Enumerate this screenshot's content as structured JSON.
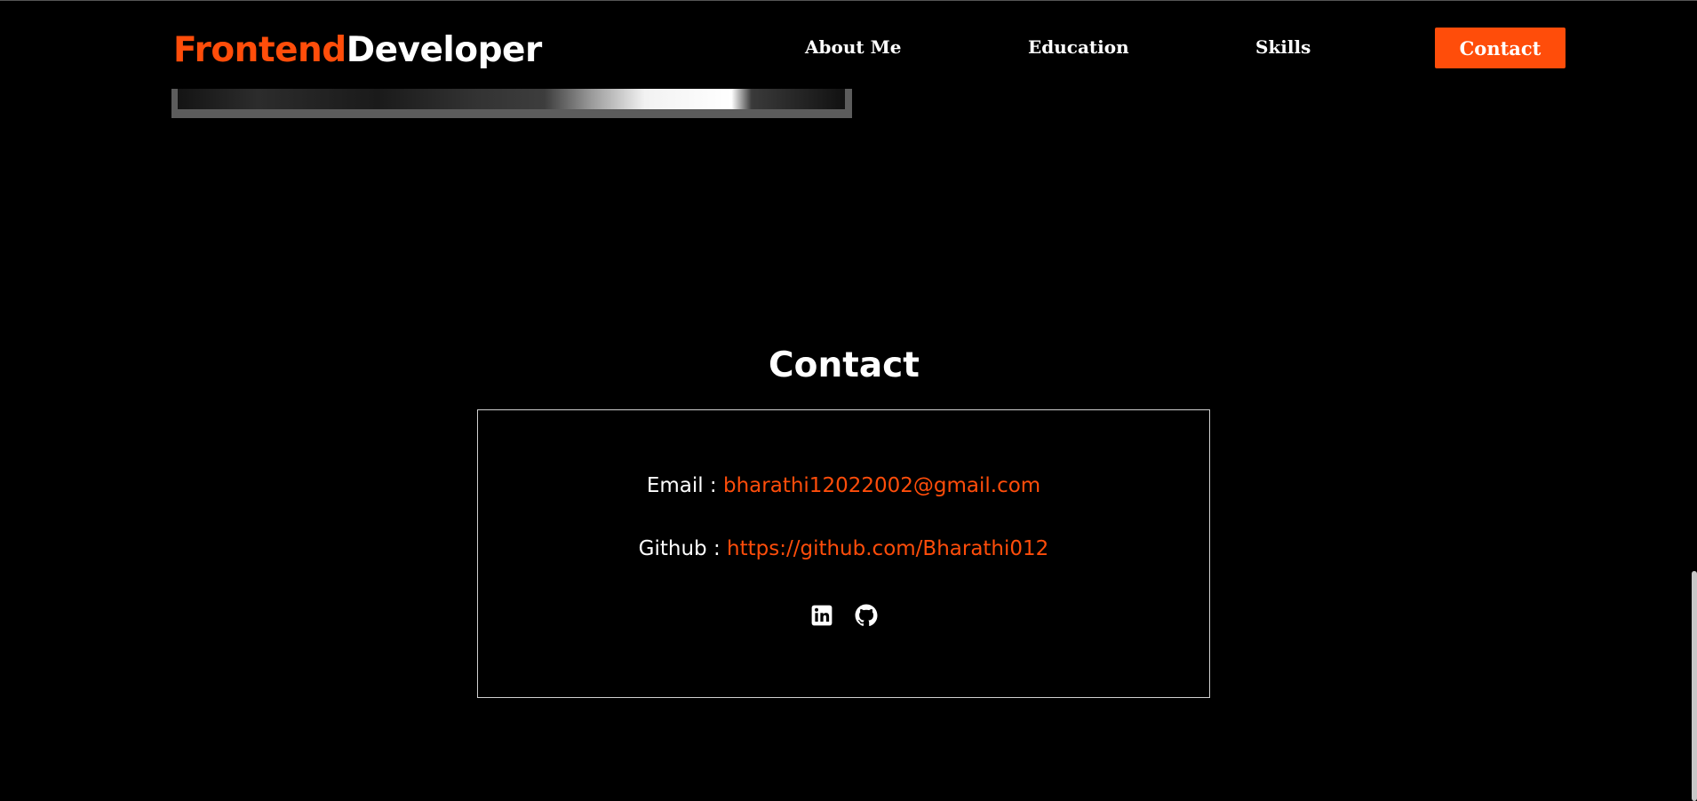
{
  "header": {
    "brand_accent": "Frontend",
    "brand_plain": "Developer",
    "nav": {
      "about": "About Me",
      "education": "Education",
      "skills": "Skills",
      "contact": "Contact"
    }
  },
  "contact": {
    "title": "Contact",
    "email_label": "Email : ",
    "email_value": "bharathi12022002@gmail.com",
    "github_label": "Github : ",
    "github_value": "https://github.com/Bharathi012",
    "social_icons": [
      "linkedin-icon",
      "github-icon"
    ]
  },
  "colors": {
    "accent": "#ff4d0a",
    "background": "#000000",
    "text": "#ffffff"
  }
}
